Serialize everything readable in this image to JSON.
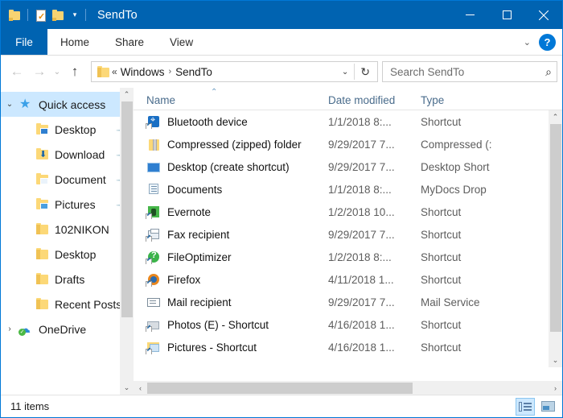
{
  "window": {
    "title": "SendTo",
    "qat": [
      {
        "name": "folder-icon",
        "label": "Folder"
      },
      {
        "name": "properties-icon",
        "label": "Properties"
      },
      {
        "name": "new-folder-icon",
        "label": "New folder"
      }
    ],
    "qat_dropdown": "▾",
    "controls": {
      "minimize": "—",
      "maximize": "◻",
      "close": "✕"
    }
  },
  "ribbon": {
    "tabs": [
      {
        "label": "File",
        "active": true
      },
      {
        "label": "Home",
        "active": false
      },
      {
        "label": "Share",
        "active": false
      },
      {
        "label": "View",
        "active": false
      }
    ],
    "collapse": "⌄",
    "help": "?"
  },
  "address": {
    "back": "←",
    "forward": "→",
    "recent": "⌄",
    "up": "↑",
    "crumb_prefix": "«",
    "crumbs": [
      "Windows",
      "SendTo"
    ],
    "crumb_arrow": "›",
    "dropdown": "⌄",
    "refresh": "↻"
  },
  "search": {
    "placeholder": "Search SendTo",
    "value": "",
    "icon": "⌕"
  },
  "navpane": {
    "items": [
      {
        "label": "Quick access",
        "icon": "star-icon",
        "twisty": "⌄",
        "indent": 0,
        "selected": true,
        "pinned": false
      },
      {
        "label": "Desktop",
        "icon": "folder-desktop-icon",
        "twisty": "",
        "indent": 1,
        "selected": false,
        "pinned": true
      },
      {
        "label": "Download",
        "icon": "folder-download-icon",
        "twisty": "",
        "indent": 1,
        "selected": false,
        "pinned": true
      },
      {
        "label": "Document",
        "icon": "folder-documents-icon",
        "twisty": "",
        "indent": 1,
        "selected": false,
        "pinned": true
      },
      {
        "label": "Pictures",
        "icon": "folder-pictures-icon",
        "twisty": "",
        "indent": 1,
        "selected": false,
        "pinned": true
      },
      {
        "label": "102NIKON",
        "icon": "folder-icon",
        "twisty": "",
        "indent": 1,
        "selected": false,
        "pinned": false
      },
      {
        "label": "Desktop",
        "icon": "folder-icon",
        "twisty": "",
        "indent": 1,
        "selected": false,
        "pinned": false
      },
      {
        "label": "Drafts",
        "icon": "folder-icon",
        "twisty": "",
        "indent": 1,
        "selected": false,
        "pinned": false
      },
      {
        "label": "Recent Posts",
        "icon": "folder-icon",
        "twisty": "",
        "indent": 1,
        "selected": false,
        "pinned": false
      },
      {
        "label": "OneDrive",
        "icon": "onedrive-icon",
        "twisty": "›",
        "indent": 0,
        "selected": false,
        "pinned": false
      }
    ],
    "scroll_up": "⌃",
    "scroll_down": "⌄"
  },
  "filelist": {
    "columns": [
      {
        "label": "Name",
        "sorted": "asc"
      },
      {
        "label": "Date modified",
        "sorted": ""
      },
      {
        "label": "Type",
        "sorted": ""
      }
    ],
    "sort_caret": "⌃",
    "rows": [
      {
        "name": "Bluetooth device",
        "date": "1/1/2018 8:...",
        "type": "Shortcut",
        "icon": "bluetooth-icon"
      },
      {
        "name": "Compressed (zipped) folder",
        "date": "9/29/2017 7...",
        "type": "Compressed (:",
        "icon": "zip-folder-icon"
      },
      {
        "name": "Desktop (create shortcut)",
        "date": "9/29/2017 7...",
        "type": "Desktop Short",
        "icon": "desktop-icon"
      },
      {
        "name": "Documents",
        "date": "1/1/2018 8:...",
        "type": "MyDocs Drop",
        "icon": "documents-icon"
      },
      {
        "name": "Evernote",
        "date": "1/2/2018 10...",
        "type": "Shortcut",
        "icon": "evernote-icon"
      },
      {
        "name": "Fax recipient",
        "date": "9/29/2017 7...",
        "type": "Shortcut",
        "icon": "fax-icon"
      },
      {
        "name": "FileOptimizer",
        "date": "1/2/2018 8:...",
        "type": "Shortcut",
        "icon": "fileoptimizer-icon"
      },
      {
        "name": "Firefox",
        "date": "4/11/2018 1...",
        "type": "Shortcut",
        "icon": "firefox-icon"
      },
      {
        "name": "Mail recipient",
        "date": "9/29/2017 7...",
        "type": "Mail Service",
        "icon": "mail-icon"
      },
      {
        "name": "Photos (E) - Shortcut",
        "date": "4/16/2018 1...",
        "type": "Shortcut",
        "icon": "photos-icon"
      },
      {
        "name": "Pictures - Shortcut",
        "date": "4/16/2018 1...",
        "type": "Shortcut",
        "icon": "pictures-icon"
      }
    ],
    "scroll_up": "⌃",
    "scroll_down": "⌄",
    "scroll_left": "‹",
    "scroll_right": "›"
  },
  "statusbar": {
    "item_count": "11 items",
    "views": [
      {
        "name": "details-view",
        "active": true
      },
      {
        "name": "large-icons-view",
        "active": false
      }
    ]
  },
  "colors": {
    "titlebar": "#0063b1",
    "accent": "#0078d7",
    "selection": "#cce8ff",
    "header_text": "#4a6c8c"
  }
}
